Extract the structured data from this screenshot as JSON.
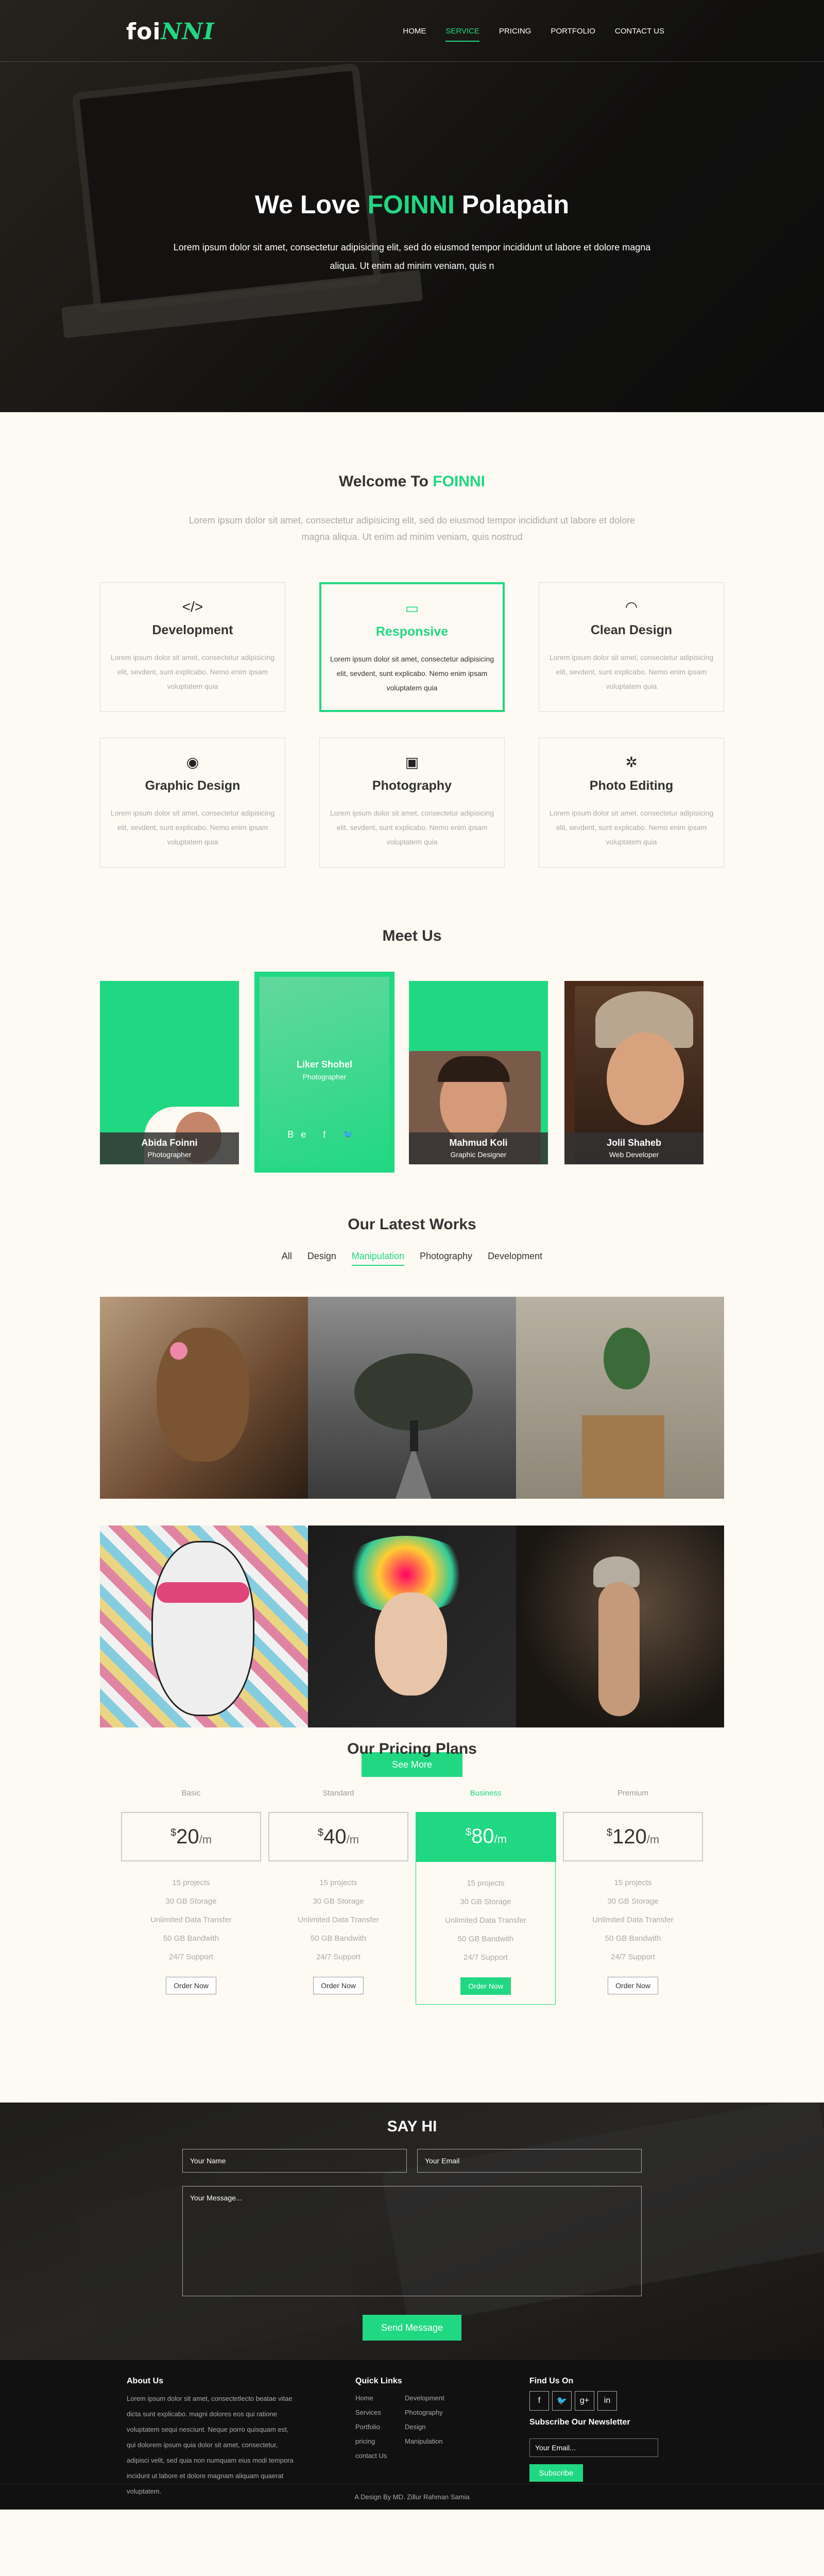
{
  "brand": {
    "logo_a": "foi",
    "logo_b": "NNI",
    "accent": "#21d882"
  },
  "nav": {
    "items": [
      "HOME",
      "SERVICE",
      "PRICING",
      "PORTFOLIO",
      "CONTACT US"
    ],
    "active": "SERVICE"
  },
  "hero": {
    "title_pre": "We Love ",
    "title_brand": "FOINNI",
    "title_post": " Polapain",
    "text": "Lorem ipsum dolor sit amet, consectetur adipisicing elit, sed do eiusmod tempor incididunt ut labore et dolore magna aliqua. Ut enim ad minim veniam, quis n"
  },
  "welcome": {
    "title_pre": "Welcome To ",
    "title_brand": "FOINNI",
    "lead": "Lorem ipsum dolor sit amet, consectetur adipisicing elit, sed do eiusmod tempor incididunt ut labore et dolore magna aliqua. Ut enim ad minim veniam, quis nostrud"
  },
  "services": [
    {
      "icon": "code-icon",
      "glyph": "</>",
      "title": "Development",
      "text": "Lorem ipsum dolor sit amet, consectetur adipisicing elit, sevdent, sunt explicabo. Nemo enim ipsam voluptatem quia"
    },
    {
      "icon": "monitor-icon",
      "glyph": "▭",
      "title": "Responsive",
      "text": "Lorem ipsum dolor sit amet, consectetur adipisicing elit, sevdent, sunt explicabo. Nemo enim ipsam voluptatem quia"
    },
    {
      "icon": "wifi-icon",
      "glyph": "◠",
      "title": "Clean Design",
      "text": "Lorem ipsum dolor sit amet, consectetur adipisicing elit, sevdent, sunt explicabo. Nemo enim ipsam voluptatem quia"
    },
    {
      "icon": "eye-icon",
      "glyph": "◉",
      "title": "Graphic Design",
      "text": "Lorem ipsum dolor sit amet, consectetur adipisicing elit, sevdent, sunt explicabo. Nemo enim ipsam voluptatem quia"
    },
    {
      "icon": "camera-icon",
      "glyph": "▣",
      "title": "Photography",
      "text": "Lorem ipsum dolor sit amet, consectetur adipisicing elit, sevdent, sunt explicabo. Nemo enim ipsam voluptatem quia"
    },
    {
      "icon": "sun-icon",
      "glyph": "✲",
      "title": "Photo Editing",
      "text": "Lorem ipsum dolor sit amet, consectetur adipisicing elit, sevdent, sunt explicabo. Nemo enim ipsam voluptatem quia"
    }
  ],
  "team": {
    "title": "Meet Us",
    "members": [
      {
        "name": "Abida Foinni",
        "role": "Photographer"
      },
      {
        "name": "Liker Shohel",
        "role": "Photographer",
        "social": "Be  f  🐦"
      },
      {
        "name": "Mahmud Koli",
        "role": "Graphic Designer"
      },
      {
        "name": "Jolil Shaheb",
        "role": "Web Developer"
      }
    ]
  },
  "works": {
    "title": "Our Latest Works",
    "filters": [
      "All",
      "Design",
      "Manipulation",
      "Photography",
      "Development"
    ],
    "active": "Manipulation",
    "see_more": "See More"
  },
  "pricing": {
    "title": "Our Pricing Plans",
    "plans": [
      {
        "name": "Basic",
        "currency": "$",
        "price": "20",
        "per": "/m",
        "features": [
          "15 projects",
          "30 GB Storage",
          "Unlimited Data Transfer",
          "50 GB Bandwith",
          "24/7 Support"
        ],
        "cta": "Order Now"
      },
      {
        "name": "Standard",
        "currency": "$",
        "price": "40",
        "per": "/m",
        "features": [
          "15 projects",
          "30 GB Storage",
          "Unlimited Data Transfer",
          "50 GB Bandwith",
          "24/7 Support"
        ],
        "cta": "Order Now"
      },
      {
        "name": "Business",
        "currency": "$",
        "price": "80",
        "per": "/m",
        "features": [
          "15 projects",
          "30 GB Storage",
          "Unlimited Data Transfer",
          "50 GB Bandwith",
          "24/7 Support"
        ],
        "cta": "Order Now"
      },
      {
        "name": "Premium",
        "currency": "$",
        "price": "120",
        "per": "/m",
        "features": [
          "15 projects",
          "30 GB Storage",
          "Unlimited Data Transfer",
          "50 GB Bandwith",
          "24/7 Support"
        ],
        "cta": "Order Now"
      }
    ]
  },
  "contact": {
    "title": "SAY HI",
    "name_ph": "Your Name",
    "email_ph": "Your Email",
    "message_ph": "Your Message...",
    "send": "Send Message"
  },
  "footer": {
    "about_title": "About Us",
    "about_text": "Lorem ipsum dolor sit amet, consectetlecto beatae vitae dicta sunt explicabo. magni dolores eos qui ratione voluptatem sequi nesciunt. Neque porro quisquam est, qui dolorem ipsum quia dolor sit amet, consectetur, adipisci velit, sed quia non numquam eius modi tempora incidunt ut labore et dolore magnam aliquam quaerat voluptatem.",
    "links_title": "Quick Links",
    "links": [
      "Home",
      "Development",
      "Services",
      "Photography",
      "Portfolio",
      "Design",
      "pricing",
      "Manipulation",
      "contact Us"
    ],
    "find_title": "Find Us On",
    "social": [
      "f",
      "🐦",
      "g+",
      "in"
    ],
    "news_title": "Subscribe Our Newsletter",
    "email_ph": "Your Email...",
    "subscribe": "Subscribe",
    "copyright": "A Design By MD. Zillur Rahman Samia"
  }
}
